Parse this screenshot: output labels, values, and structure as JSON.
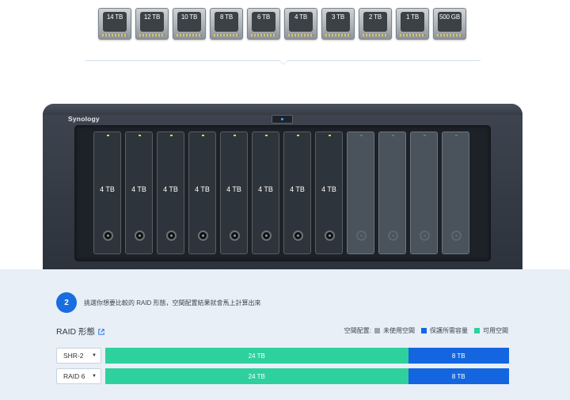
{
  "disks": [
    {
      "label": "14 TB"
    },
    {
      "label": "12 TB"
    },
    {
      "label": "10 TB"
    },
    {
      "label": "8 TB"
    },
    {
      "label": "6 TB"
    },
    {
      "label": "4 TB"
    },
    {
      "label": "3 TB"
    },
    {
      "label": "2 TB"
    },
    {
      "label": "1 TB"
    },
    {
      "label": "500 GB"
    }
  ],
  "nas": {
    "brand": "Synology",
    "bays": [
      {
        "label": "4 TB",
        "filled": true
      },
      {
        "label": "4 TB",
        "filled": true
      },
      {
        "label": "4 TB",
        "filled": true
      },
      {
        "label": "4 TB",
        "filled": true
      },
      {
        "label": "4 TB",
        "filled": true
      },
      {
        "label": "4 TB",
        "filled": true
      },
      {
        "label": "4 TB",
        "filled": true
      },
      {
        "label": "4 TB",
        "filled": true
      },
      {
        "label": "",
        "filled": false
      },
      {
        "label": "",
        "filled": false
      },
      {
        "label": "",
        "filled": false
      },
      {
        "label": "",
        "filled": false
      }
    ]
  },
  "step": {
    "number": "2",
    "text": "挑選你想要比較的 RAID 形態，空間配置結果就會馬上計算出來"
  },
  "raid": {
    "title": "RAID 形態",
    "legend_title": "空間配置:",
    "legend": [
      {
        "label": "未使用空間",
        "color": "#9aa5b1"
      },
      {
        "label": "保護所需容量",
        "color": "#1466e0"
      },
      {
        "label": "可用空間",
        "color": "#2ed19d"
      }
    ],
    "rows": [
      {
        "select": "SHR-2",
        "usable": "24 TB",
        "protect": "8 TB",
        "usable_fraction": 0.75
      },
      {
        "select": "RAID 6",
        "usable": "24 TB",
        "protect": "8 TB",
        "usable_fraction": 0.75
      }
    ]
  },
  "colors": {
    "accent": "#1a6de0",
    "usable": "#2ed19d",
    "protection": "#1466e0",
    "unused": "#9aa5b1"
  }
}
